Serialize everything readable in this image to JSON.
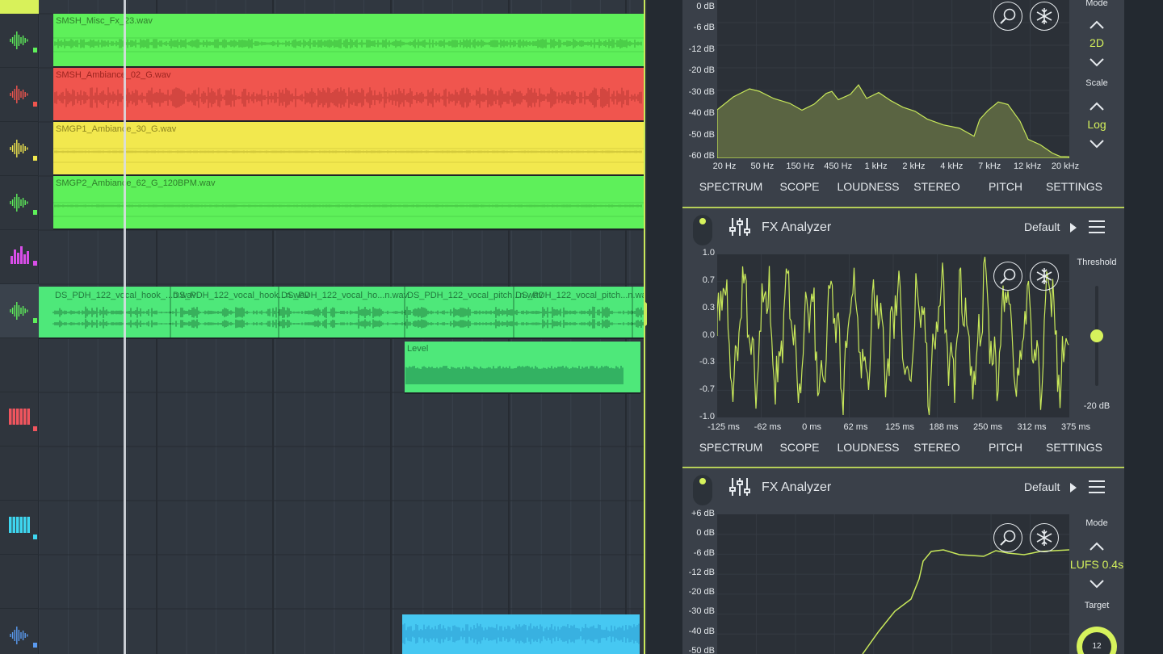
{
  "tracks": [
    {
      "icon": "waveform-icon",
      "color": "#5ef05a"
    },
    {
      "icon": "waveform-icon",
      "color": "#f0554e"
    },
    {
      "icon": "waveform-icon",
      "color": "#f2e84e"
    },
    {
      "icon": "waveform-icon",
      "color": "#5ef05a"
    },
    {
      "icon": "equalizer-bars-icon",
      "color": "#d84ee8"
    },
    {
      "icon": "waveform-icon",
      "color": "#5ef05a"
    },
    {
      "icon": "blank",
      "color": ""
    },
    {
      "icon": "piano-keys-icon",
      "color": "#f0555e"
    },
    {
      "icon": "blank",
      "color": ""
    },
    {
      "icon": "piano-keys-icon",
      "color": "#3ed6f0"
    },
    {
      "icon": "blank",
      "color": ""
    },
    {
      "icon": "waveform-icon",
      "color": "#5a9af0"
    }
  ],
  "clips": {
    "c1": "SMSH_Misc_Fx_23.wav",
    "c2": "SMSH_Ambiance_02_G.wav",
    "c3": "SMGP1_Ambiance_30_G.wav",
    "c4": "SMGP2_Ambiance_62_G_120BPM.wav",
    "vocal1": "DS_PDH_122_vocal_hook_...n.wav",
    "vocal2": "DS_PDH_122_vocal_hook...n.wav",
    "vocal3": "DS_PDH_122_vocal_ho...n.wav",
    "vocal4": "DS_PDH_122_vocal_pitch...n.wav",
    "vocal5": "DS_PDH_122_vocal_pitch...n.wav",
    "vocal6": "DS_PDH_122_vocal_...",
    "level": "Level"
  },
  "colors": {
    "accent": "#d6f25c",
    "green_clip": "#5ef05a",
    "red_clip": "#f0554e",
    "yellow_clip": "#f2e84e",
    "vocal_clip": "#4ee87a",
    "blue_clip": "#46c8f2"
  },
  "tabs": [
    "SPECTRUM",
    "SCOPE",
    "LOUDNESS",
    "STEREO",
    "PITCH",
    "SETTINGS"
  ],
  "panel1": {
    "y_labels": [
      "0 dB",
      "-6 dB",
      "-12 dB",
      "-20 dB",
      "-30 dB",
      "-40 dB",
      "-50 dB",
      "-60 dB"
    ],
    "x_labels": [
      "20 Hz",
      "50 Hz",
      "150 Hz",
      "450 Hz",
      "1 kHz",
      "2 kHz",
      "4 kHz",
      "7 kHz",
      "12 kHz",
      "20 kHz"
    ],
    "mode_label": "Mode",
    "mode_value": "2D",
    "scale_label": "Scale",
    "scale_value": "Log"
  },
  "panel2": {
    "title": "FX Analyzer",
    "preset": "Default",
    "y_labels": [
      "1.0",
      "0.7",
      "0.3",
      "0.0",
      "-0.3",
      "-0.7",
      "-1.0"
    ],
    "x_labels": [
      "-125 ms",
      "-62 ms",
      "0 ms",
      "62 ms",
      "125 ms",
      "188 ms",
      "250 ms",
      "312 ms",
      "375 ms"
    ],
    "threshold_label": "Threshold",
    "threshold_value": "-20 dB"
  },
  "panel3": {
    "title": "FX Analyzer",
    "preset": "Default",
    "y_labels": [
      "+6 dB",
      "0 dB",
      "-6 dB",
      "-12 dB",
      "-20 dB",
      "-30 dB",
      "-40 dB",
      "-50 dB"
    ],
    "mode_label": "Mode",
    "mode_value": "LUFS 0.4s",
    "target_label": "Target",
    "target_value": "12"
  }
}
